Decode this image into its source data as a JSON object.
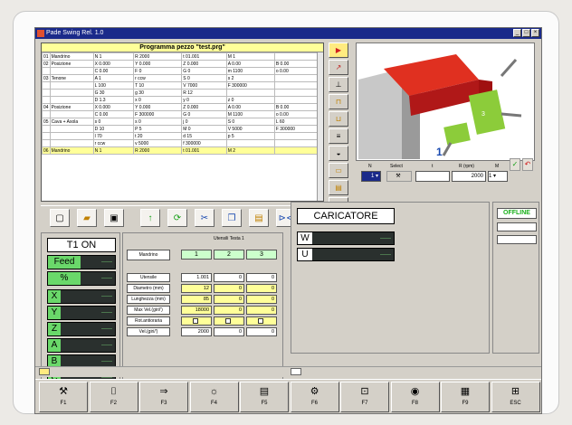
{
  "app_title": "Pade Swing Rel. 1.0",
  "program": {
    "title": "Programma pezzo \"test.prg\"",
    "rows": [
      {
        "n": "01",
        "group": "Mandrino",
        "cells": [
          "N 1",
          "R 2000",
          "t 01.001",
          "M 1",
          ""
        ]
      },
      {
        "n": "02",
        "group": "Posizione",
        "cells": [
          "X 0.000",
          "Y 0.000",
          "Z 0.000",
          "A 0.00",
          "B 0.00"
        ]
      },
      {
        "n": "",
        "group": "",
        "cells": [
          "C 0.00",
          "F 0",
          "G 0",
          "m 1100",
          "o 0.00"
        ]
      },
      {
        "n": "03",
        "group": "Tenone",
        "cells": [
          "A 1",
          "r ccw",
          "S 0",
          "s 2",
          ""
        ]
      },
      {
        "n": "",
        "group": "",
        "cells": [
          "L 100",
          "T 10",
          "V 7000",
          "F 300000",
          ""
        ]
      },
      {
        "n": "",
        "group": "",
        "cells": [
          "G 30",
          "g 30",
          "R 12",
          "",
          ""
        ]
      },
      {
        "n": "",
        "group": "",
        "cells": [
          "D 1.3",
          "x 0",
          "y 0",
          "z 0",
          ""
        ]
      },
      {
        "n": "04",
        "group": "Posizione",
        "cells": [
          "X 0.000",
          "Y 0.000",
          "Z 0.000",
          "A 0.00",
          "B 0.00"
        ]
      },
      {
        "n": "",
        "group": "",
        "cells": [
          "C 0.00",
          "F 300000",
          "G 0",
          "M 1100",
          "o 0.00"
        ]
      },
      {
        "n": "05",
        "group": "Cava + Asola",
        "cells": [
          "s 0",
          "s 0",
          "j 0",
          "S 0",
          "L 60"
        ]
      },
      {
        "n": "",
        "group": "",
        "cells": [
          "D 10",
          "P 5",
          "M 0",
          "V 5000",
          "F 300000"
        ]
      },
      {
        "n": "",
        "group": "",
        "cells": [
          "l 70",
          "t 20",
          "d 15",
          "p 5",
          ""
        ]
      },
      {
        "n": "",
        "group": "",
        "cells": [
          "r ccw",
          "v 5000",
          "f 300000",
          "",
          ""
        ]
      },
      {
        "n": "06",
        "group": "Mandrino",
        "cells": [
          "N 1",
          "R 2000",
          "t 01.001",
          "M 2",
          ""
        ]
      }
    ]
  },
  "ctrl": {
    "n_label": "N",
    "select_label": "Select",
    "t_label": "t",
    "r_label": "R (rpm)",
    "m_label": "M",
    "n_value": "1",
    "t_value": "",
    "r_value": "2000",
    "m_value": "1",
    "ok": "✓",
    "cancel": "↶"
  },
  "left_panel": {
    "t1_label": "T1 ON",
    "feed_label": "Feed",
    "pct_label": "%",
    "feed_value": "------",
    "pct_value": "------",
    "axes": [
      {
        "label": "X",
        "value": "------"
      },
      {
        "label": "Y",
        "value": "------"
      },
      {
        "label": "Z",
        "value": "------"
      },
      {
        "label": "A",
        "value": "------"
      },
      {
        "label": "B",
        "value": "------"
      },
      {
        "label": "C",
        "value": "------"
      }
    ]
  },
  "tools": {
    "title": "Utensili Testa 1",
    "mandrino_label": "Mandrino",
    "headers": [
      "1",
      "2",
      "3"
    ],
    "rows": [
      {
        "label": "Utensile",
        "values": [
          "1.001",
          "0",
          "0"
        ]
      },
      {
        "label": "Diametro (mm)",
        "values": [
          "12",
          "0",
          "0"
        ]
      },
      {
        "label": "Lunghezza (mm)",
        "values": [
          "85",
          "0",
          "0"
        ]
      },
      {
        "label": "Max Vel.(giri/')",
        "values": [
          "18000",
          "0",
          "0"
        ]
      },
      {
        "label": "Rot.antioraria",
        "values": [
          "",
          "",
          ""
        ]
      },
      {
        "label": "Vel.(giri/')",
        "values": [
          "2000",
          "0",
          "0"
        ]
      }
    ]
  },
  "caricatore": {
    "title": "CARICATORE",
    "w_label": "W",
    "u_label": "U",
    "w_value": "------",
    "u_value": "------"
  },
  "status": {
    "offline": "OFFLINE"
  },
  "fkeys": [
    "F1",
    "F2",
    "F3",
    "F4",
    "F5",
    "F6",
    "F7",
    "F8",
    "F9",
    "ESC"
  ],
  "colors": {
    "titlebar": "#1a2a8a",
    "accent_yellow": "#ffff99",
    "axis_green": "#6ad86a",
    "display_dark": "#2a302e",
    "tool_red": "#e03020"
  }
}
